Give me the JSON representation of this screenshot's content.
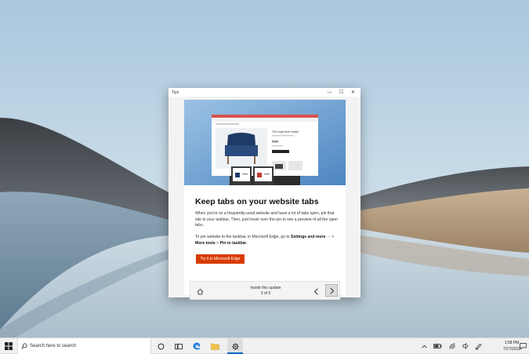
{
  "window": {
    "title": "Tips",
    "controls": {
      "minimize": "—",
      "maximize": "☐",
      "close": "✕"
    }
  },
  "tip": {
    "heading": "Keep tabs on your website tabs",
    "paragraph1": "When you're on a frequently-used website and have a lot of tabs open, pin that site to your taskbar. Then, just hover over the pin to see a preview of all the open tabs.",
    "paragraph2": {
      "part1": "To pin website to the taskbar, in Microsoft Edge, go to ",
      "settings": "Settings and more",
      "ellipsis": " ··· ",
      "sep": " > ",
      "more_tools": "More tools",
      "sep2": " > ",
      "pin": "Pin to taskbar",
      "end": "."
    },
    "cta_label": "Try it in Microsoft Edge",
    "hero_product_title": "The royal blue chaise"
  },
  "nav": {
    "label": "Inside this update",
    "counter": "3 of 5"
  },
  "taskbar": {
    "search_placeholder": "Search here to search",
    "time": "1:58 PM",
    "date": "7/27/2018"
  },
  "colors": {
    "accent": "#d83b01",
    "taskbar_active": "#0a64c8"
  }
}
